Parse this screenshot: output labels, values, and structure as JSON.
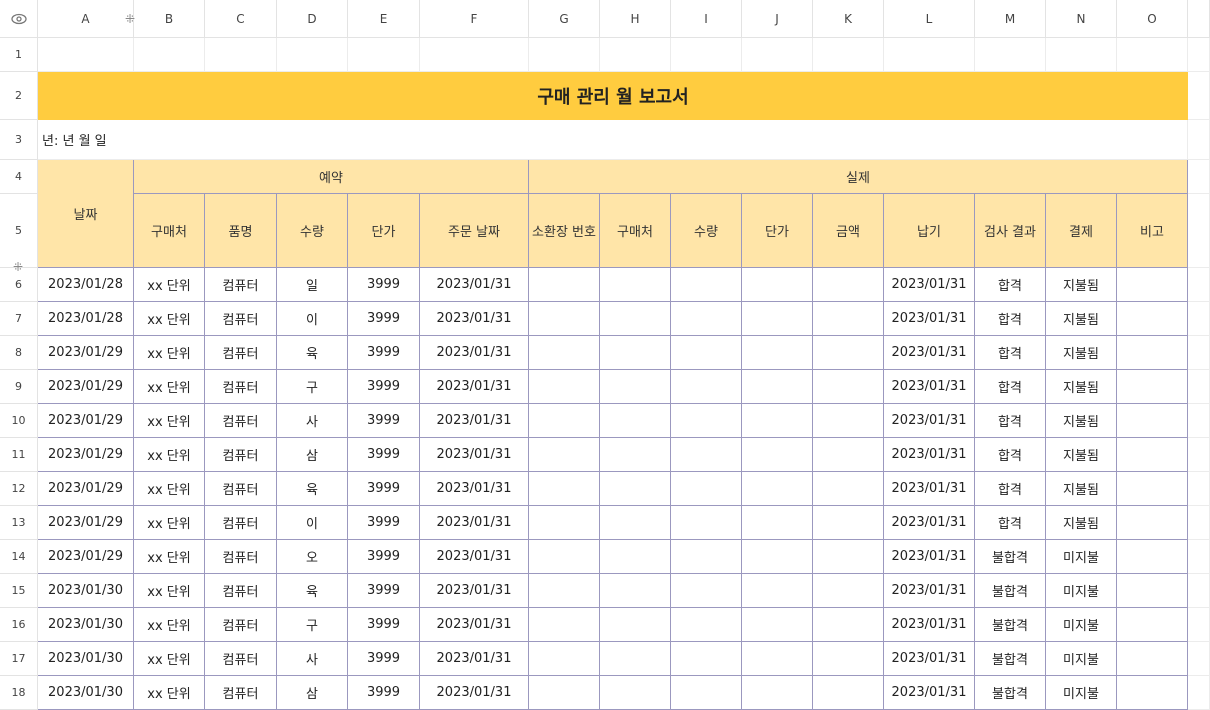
{
  "columns": [
    "A",
    "B",
    "C",
    "D",
    "E",
    "F",
    "G",
    "H",
    "I",
    "J",
    "K",
    "L",
    "M",
    "N",
    "O"
  ],
  "rows": [
    "1",
    "2",
    "3",
    "4",
    "5",
    "6",
    "7",
    "8",
    "9",
    "10",
    "11",
    "12",
    "13",
    "14",
    "15",
    "16",
    "17",
    "18"
  ],
  "eye_icon": "eye-icon",
  "title": "구매 관리 월 보고서",
  "year_line": "년: 년 월 일",
  "headers": {
    "date": "날짜",
    "plan": "예약",
    "actual": "실제",
    "plan_cols": [
      "구매처",
      "품명",
      "수량",
      "단가",
      "주문 날짜"
    ],
    "actual_cols": [
      "소환장 번호",
      "구매처",
      "수량",
      "단가",
      "금액",
      "납기",
      "검사 결과",
      "결제",
      "비고"
    ]
  },
  "table_rows": [
    {
      "date": "2023/01/28",
      "vendor": "xx 단위",
      "item": "컴퓨터",
      "qty": "일",
      "price": "3999",
      "order_date": "2023/01/31",
      "due": "2023/01/31",
      "result": "합격",
      "payment": "지불됨"
    },
    {
      "date": "2023/01/28",
      "vendor": "xx 단위",
      "item": "컴퓨터",
      "qty": "이",
      "price": "3999",
      "order_date": "2023/01/31",
      "due": "2023/01/31",
      "result": "합격",
      "payment": "지불됨"
    },
    {
      "date": "2023/01/29",
      "vendor": "xx 단위",
      "item": "컴퓨터",
      "qty": "육",
      "price": "3999",
      "order_date": "2023/01/31",
      "due": "2023/01/31",
      "result": "합격",
      "payment": "지불됨"
    },
    {
      "date": "2023/01/29",
      "vendor": "xx 단위",
      "item": "컴퓨터",
      "qty": "구",
      "price": "3999",
      "order_date": "2023/01/31",
      "due": "2023/01/31",
      "result": "합격",
      "payment": "지불됨"
    },
    {
      "date": "2023/01/29",
      "vendor": "xx 단위",
      "item": "컴퓨터",
      "qty": "사",
      "price": "3999",
      "order_date": "2023/01/31",
      "due": "2023/01/31",
      "result": "합격",
      "payment": "지불됨"
    },
    {
      "date": "2023/01/29",
      "vendor": "xx 단위",
      "item": "컴퓨터",
      "qty": "삼",
      "price": "3999",
      "order_date": "2023/01/31",
      "due": "2023/01/31",
      "result": "합격",
      "payment": "지불됨"
    },
    {
      "date": "2023/01/29",
      "vendor": "xx 단위",
      "item": "컴퓨터",
      "qty": "육",
      "price": "3999",
      "order_date": "2023/01/31",
      "due": "2023/01/31",
      "result": "합격",
      "payment": "지불됨"
    },
    {
      "date": "2023/01/29",
      "vendor": "xx 단위",
      "item": "컴퓨터",
      "qty": "이",
      "price": "3999",
      "order_date": "2023/01/31",
      "due": "2023/01/31",
      "result": "합격",
      "payment": "지불됨"
    },
    {
      "date": "2023/01/29",
      "vendor": "xx 단위",
      "item": "컴퓨터",
      "qty": "오",
      "price": "3999",
      "order_date": "2023/01/31",
      "due": "2023/01/31",
      "result": "불합격",
      "payment": "미지불"
    },
    {
      "date": "2023/01/30",
      "vendor": "xx 단위",
      "item": "컴퓨터",
      "qty": "육",
      "price": "3999",
      "order_date": "2023/01/31",
      "due": "2023/01/31",
      "result": "불합격",
      "payment": "미지불"
    },
    {
      "date": "2023/01/30",
      "vendor": "xx 단위",
      "item": "컴퓨터",
      "qty": "구",
      "price": "3999",
      "order_date": "2023/01/31",
      "due": "2023/01/31",
      "result": "불합격",
      "payment": "미지불"
    },
    {
      "date": "2023/01/30",
      "vendor": "xx 단위",
      "item": "컴퓨터",
      "qty": "사",
      "price": "3999",
      "order_date": "2023/01/31",
      "due": "2023/01/31",
      "result": "불합격",
      "payment": "미지불"
    },
    {
      "date": "2023/01/30",
      "vendor": "xx 단위",
      "item": "컴퓨터",
      "qty": "삼",
      "price": "3999",
      "order_date": "2023/01/31",
      "due": "2023/01/31",
      "result": "불합격",
      "payment": "미지불"
    }
  ],
  "colors": {
    "title_bg": "#FFCC3F",
    "header_bg": "#FFE5A8",
    "border": "#9b98bf"
  }
}
